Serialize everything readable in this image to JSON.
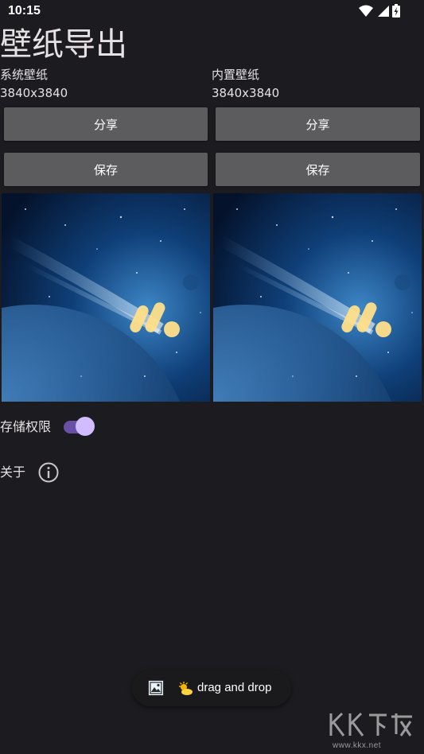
{
  "status_bar": {
    "time": "10:15",
    "icons": [
      "wifi-icon",
      "signal-icon",
      "battery-charging-icon"
    ]
  },
  "page": {
    "title": "壁纸导出"
  },
  "system_wallpaper": {
    "label": "系统壁纸",
    "resolution": "3840x3840",
    "share_label": "分享",
    "save_label": "保存"
  },
  "builtin_wallpaper": {
    "label": "内置壁纸",
    "resolution": "3840x3840",
    "share_label": "分享",
    "save_label": "保存"
  },
  "settings": {
    "storage_permission_label": "存储权限",
    "storage_permission_enabled": true,
    "about_label": "关于"
  },
  "drag_drop": {
    "label": "drag and drop"
  },
  "watermark": {
    "logo_text": "KK下载",
    "url": "www.kkx.net"
  },
  "colors": {
    "background": "#1c1b1f",
    "button": "#5c5c5e",
    "switch_track": "#6a4fa8",
    "switch_thumb": "#d0bcff"
  }
}
